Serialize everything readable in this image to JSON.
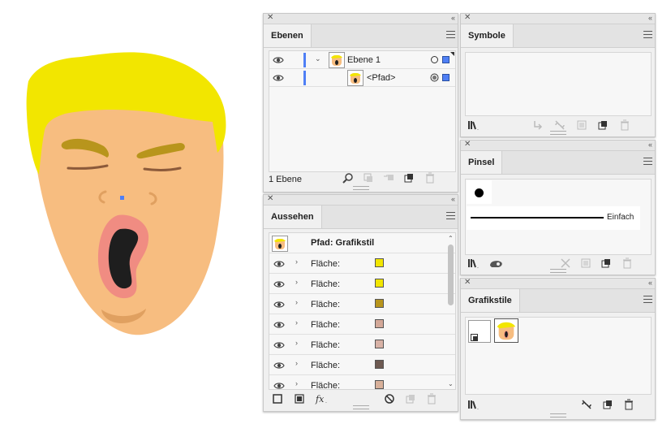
{
  "layers_panel": {
    "tab": "Ebenen",
    "layers": [
      {
        "name": "Ebene 1",
        "color": "#4f7ff5"
      },
      {
        "name": "<Pfad>",
        "color": "#4f7ff5"
      }
    ],
    "status": "1 Ebene"
  },
  "appearance_panel": {
    "tab": "Aussehen",
    "header": "Pfad: Grafikstil",
    "fill_label": "Fläche:",
    "fills": [
      {
        "label": "Fläche:",
        "color": "#f2e600"
      },
      {
        "label": "Fläche:",
        "color": "#f2e600"
      },
      {
        "label": "Fläche:",
        "color": "#b8951c"
      },
      {
        "label": "Fläche:",
        "color": "#d3a898"
      },
      {
        "label": "Fläche:",
        "color": "#d8b2a6"
      },
      {
        "label": "Fläche:",
        "color": "#6e5a52"
      },
      {
        "label": "Fläche:",
        "color": "#d8b09a"
      }
    ]
  },
  "symbols_panel": {
    "tab": "Symbole"
  },
  "brushes_panel": {
    "tab": "Pinsel",
    "brush_name": "Einfach"
  },
  "graphic_styles_panel": {
    "tab": "Grafikstile"
  },
  "artwork_colors": {
    "hair": "#f2e600",
    "skin": "#f7bd80",
    "brow": "#b8951c",
    "lash": "#8c5a3a",
    "mouth_outer": "#f08c82",
    "mouth_inner": "#1e1e1e",
    "selection": "#4f7ff5"
  }
}
